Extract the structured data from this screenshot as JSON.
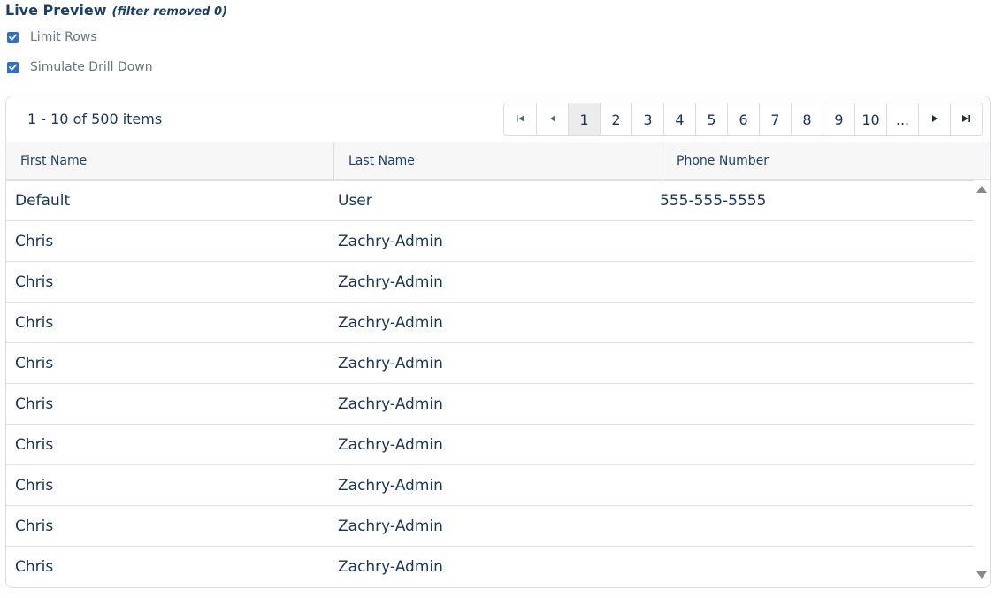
{
  "header": {
    "title": "Live Preview",
    "subtitle": "(filter removed 0)"
  },
  "options": {
    "limit_rows": {
      "label": "Limit Rows",
      "checked": true
    },
    "simulate_drill_down": {
      "label": "Simulate Drill Down",
      "checked": true
    }
  },
  "colors": {
    "accent": "#2f6ec9",
    "text": "#16365c",
    "header_bg": "#f7f7f7",
    "active_page_bg": "#ececec"
  },
  "pager": {
    "info": "1 - 10 of 500 items",
    "icons": {
      "first": "first-page-icon",
      "prev": "previous-page-icon",
      "next": "next-page-icon",
      "last": "last-page-icon"
    },
    "pages": [
      "1",
      "2",
      "3",
      "4",
      "5",
      "6",
      "7",
      "8",
      "9",
      "10",
      "..."
    ],
    "current_page": "1"
  },
  "table": {
    "columns": [
      "First Name",
      "Last Name",
      "Phone Number"
    ],
    "rows": [
      {
        "first": "Default",
        "last": "User",
        "phone": "555-555-5555"
      },
      {
        "first": "Chris",
        "last": "Zachry-Admin",
        "phone": ""
      },
      {
        "first": "Chris",
        "last": "Zachry-Admin",
        "phone": ""
      },
      {
        "first": "Chris",
        "last": "Zachry-Admin",
        "phone": ""
      },
      {
        "first": "Chris",
        "last": "Zachry-Admin",
        "phone": ""
      },
      {
        "first": "Chris",
        "last": "Zachry-Admin",
        "phone": ""
      },
      {
        "first": "Chris",
        "last": "Zachry-Admin",
        "phone": ""
      },
      {
        "first": "Chris",
        "last": "Zachry-Admin",
        "phone": ""
      },
      {
        "first": "Chris",
        "last": "Zachry-Admin",
        "phone": ""
      },
      {
        "first": "Chris",
        "last": "Zachry-Admin",
        "phone": ""
      }
    ]
  }
}
